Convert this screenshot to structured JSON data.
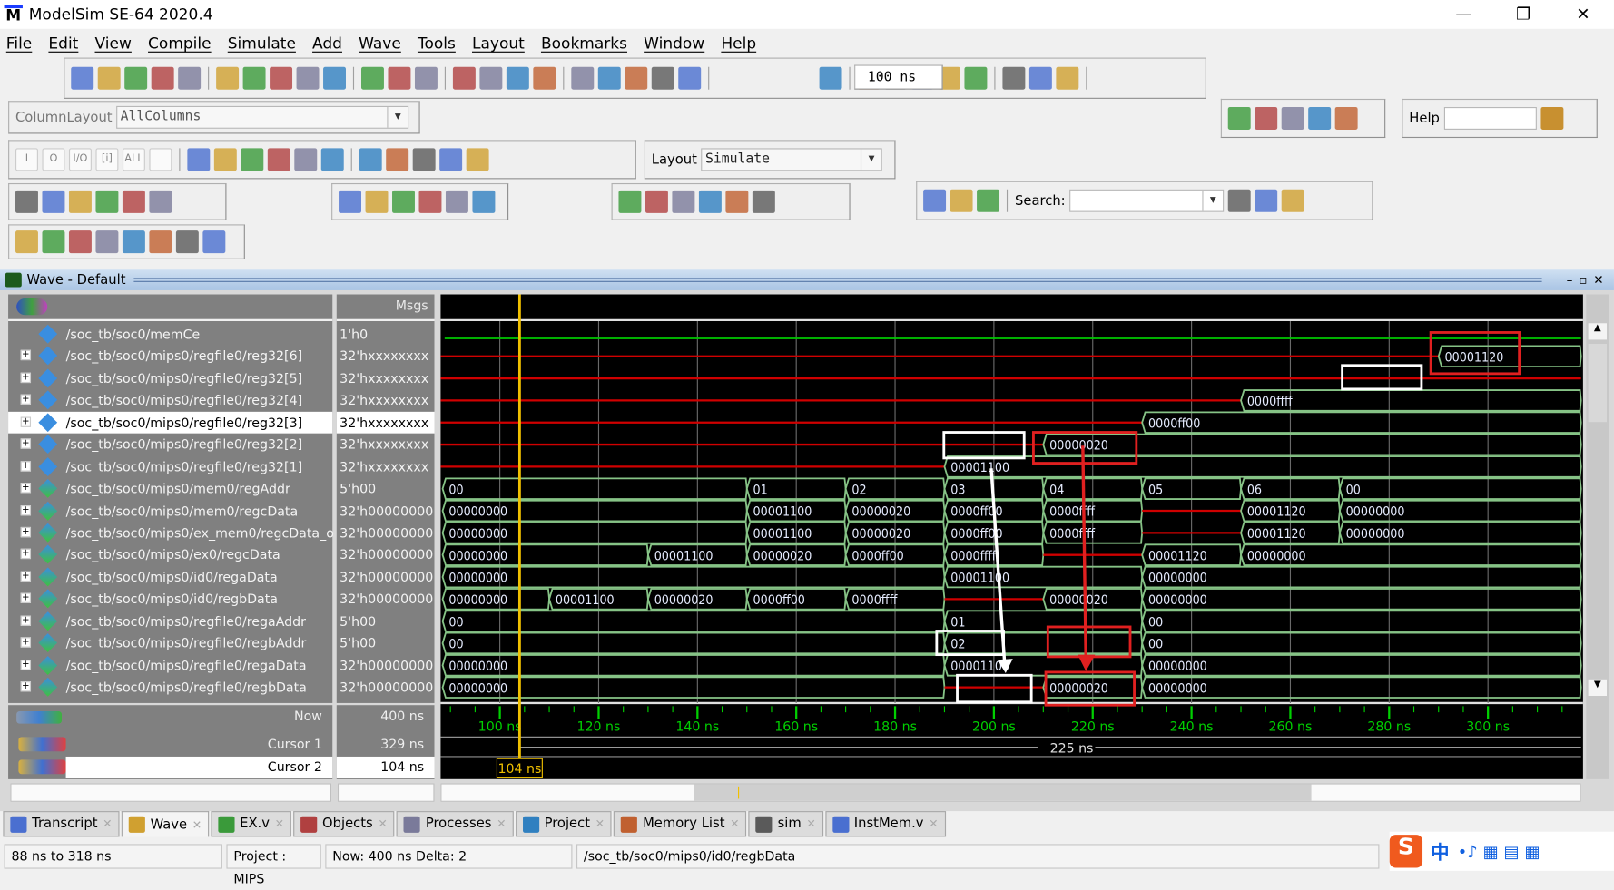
{
  "app": {
    "title": "ModelSim SE-64 2020.4",
    "logo": "M"
  },
  "window_controls": {
    "minimize": "—",
    "restore": "❐",
    "close": "✕"
  },
  "menu": [
    "File",
    "Edit",
    "View",
    "Compile",
    "Simulate",
    "Add",
    "Wave",
    "Tools",
    "Layout",
    "Bookmarks",
    "Window",
    "Help"
  ],
  "toolbar": {
    "row1_groups": [
      [
        "new-file-icon",
        "open-folder-icon",
        "save-icon",
        "reload-icon",
        "print-icon"
      ],
      [
        "cut-icon",
        "copy-icon",
        "paste-icon",
        "undo-icon",
        "redo-icon"
      ],
      [
        "add-icon",
        "find-icon",
        "collapse-icon"
      ],
      [
        "break-icon",
        "break-all-icon",
        "doc-icon",
        "wand-icon"
      ],
      [
        "compile-icon",
        "compile-all-icon",
        "up-arrow-icon",
        "back-arrow-icon",
        "forward-arrow-icon"
      ],
      [
        "restart-icon"
      ],
      [
        "run-icon",
        "continue-icon",
        "run-all-icon",
        "break-run-icon",
        "stop-icon"
      ],
      [
        "performance-icon",
        "memory-icon",
        "hand-icon"
      ]
    ],
    "run_length": "100 ns",
    "column_layout_label": "ColumnLayout",
    "column_layout_value": "AllColumns",
    "right_icons": [
      "download-icon",
      "calendar-icon",
      "table-icon",
      "graph-icon",
      "close-file-icon"
    ],
    "help_label": "Help",
    "help_search_icon": "help-search-icon",
    "row3_filter_icons": [
      "in-filter-icon",
      "out-filter-icon",
      "inout-filter-icon",
      "internal-filter-icon",
      "all-filter-icon",
      "filter-wand-icon"
    ],
    "row3_filter_labels": [
      "I",
      "O",
      "I/O",
      "[i]",
      "ALL",
      ""
    ],
    "row3_step_icons": [
      "step-into-icon",
      "step-over-icon",
      "step-out-icon",
      "step-into-all-icon",
      "step-over-all-icon",
      "step-out-all-icon"
    ],
    "row3_obj_icons": [
      "obj-add-icon",
      "obj-remove-icon",
      "obj-edit-icon",
      "obj-list-icon",
      "obj-go-icon"
    ],
    "layout_label": "Layout",
    "layout_value": "Simulate",
    "row4_mode_icons": [
      "select-mode-icon",
      "zoom-mode-icon",
      "pan-mode-icon",
      "edit-mode-icon",
      "split-mode-icon",
      "stop-signal-icon"
    ],
    "row4_zoom_icons": [
      "zoom-in-icon",
      "zoom-out-icon",
      "zoom-full-icon",
      "zoom-cursor-icon",
      "zoom-cursors-icon",
      "zoom-region-icon"
    ],
    "row4_cursor_icons": [
      "insert-cursor-icon",
      "wave-bar-icon",
      "wave-block-icon",
      "wave-dense-icon",
      "wave-step-icon",
      "wave-edge-icon"
    ],
    "row4_find_icons": [
      "next-edge-icon",
      "prev-edge-icon",
      "find-edge-icon"
    ],
    "search_label": "Search:",
    "search_value": "",
    "search_icons": [
      "search-go-icon",
      "search-prev-icon",
      "search-next-icon"
    ],
    "row5_icons": [
      "add-cursor-icon",
      "delete-cursor-icon",
      "prev-transition-icon",
      "next-transition-icon",
      "prev-rise-icon",
      "next-rise-icon",
      "prev-fall-icon",
      "next-fall-icon"
    ]
  },
  "wave_window": {
    "title": "Wave - Default",
    "msgs_header": "Msgs",
    "now_label": "Now",
    "now_value": "400 ns",
    "cursor1_label": "Cursor 1",
    "cursor1_value": "329 ns",
    "cursor2_label": "Cursor 2",
    "cursor2_value": "104 ns",
    "cursor2_time": 104,
    "cursor_delta_label": "225 ns",
    "selected_row": 4,
    "signals": [
      {
        "name": "/soc_tb/soc0/memCe",
        "value": "1'h0",
        "bits": 1,
        "wave": [
          [
            88,
            "0"
          ]
        ]
      },
      {
        "name": "/soc_tb/soc0/mips0/regfile0/reg32[6]",
        "value": "32'hxxxxxxxx",
        "wave": [
          [
            88,
            "x"
          ],
          [
            290,
            "00001120"
          ]
        ]
      },
      {
        "name": "/soc_tb/soc0/mips0/regfile0/reg32[5]",
        "value": "32'hxxxxxxxx",
        "wave": [
          [
            88,
            "x"
          ]
        ]
      },
      {
        "name": "/soc_tb/soc0/mips0/regfile0/reg32[4]",
        "value": "32'hxxxxxxxx",
        "wave": [
          [
            88,
            "x"
          ],
          [
            250,
            "0000ffff"
          ]
        ]
      },
      {
        "name": "/soc_tb/soc0/mips0/regfile0/reg32[3]",
        "value": "32'hxxxxxxxx",
        "wave": [
          [
            88,
            "x"
          ],
          [
            230,
            "0000ff00"
          ]
        ]
      },
      {
        "name": "/soc_tb/soc0/mips0/regfile0/reg32[2]",
        "value": "32'hxxxxxxxx",
        "wave": [
          [
            88,
            "x"
          ],
          [
            210,
            "00000020"
          ]
        ]
      },
      {
        "name": "/soc_tb/soc0/mips0/regfile0/reg32[1]",
        "value": "32'hxxxxxxxx",
        "wave": [
          [
            88,
            "x"
          ],
          [
            190,
            "00001100"
          ]
        ]
      },
      {
        "name": "/soc_tb/soc0/mips0/mem0/regAddr",
        "value": "5'h00",
        "wave": [
          [
            88,
            "00"
          ],
          [
            150,
            "01"
          ],
          [
            170,
            "02"
          ],
          [
            190,
            "03"
          ],
          [
            210,
            "04"
          ],
          [
            230,
            "05"
          ],
          [
            250,
            "06"
          ],
          [
            270,
            "00"
          ]
        ]
      },
      {
        "name": "/soc_tb/soc0/mips0/mem0/regcData",
        "value": "32'h00000000",
        "wave": [
          [
            88,
            "00000000"
          ],
          [
            150,
            "00001100"
          ],
          [
            170,
            "00000020"
          ],
          [
            190,
            "0000ff00"
          ],
          [
            210,
            "0000ffff"
          ],
          [
            230,
            "x"
          ],
          [
            250,
            "00001120"
          ],
          [
            270,
            "00000000"
          ]
        ]
      },
      {
        "name": "/soc_tb/soc0/mips0/ex_mem0/regcData_o",
        "value": "32'h00000000",
        "wave": [
          [
            88,
            "00000000"
          ],
          [
            150,
            "00001100"
          ],
          [
            170,
            "00000020"
          ],
          [
            190,
            "0000ff00"
          ],
          [
            210,
            "0000ffff"
          ],
          [
            230,
            "x"
          ],
          [
            250,
            "00001120"
          ],
          [
            270,
            "00000000"
          ]
        ]
      },
      {
        "name": "/soc_tb/soc0/mips0/ex0/regcData",
        "value": "32'h00000000",
        "wave": [
          [
            88,
            "00000000"
          ],
          [
            130,
            "00001100"
          ],
          [
            150,
            "00000020"
          ],
          [
            170,
            "0000ff00"
          ],
          [
            190,
            "0000ffff"
          ],
          [
            210,
            "x"
          ],
          [
            230,
            "00001120"
          ],
          [
            250,
            "00000000"
          ]
        ]
      },
      {
        "name": "/soc_tb/soc0/mips0/id0/regaData",
        "value": "32'h00000000",
        "wave": [
          [
            88,
            "00000000"
          ],
          [
            190,
            "00001100"
          ],
          [
            230,
            "00000000"
          ]
        ]
      },
      {
        "name": "/soc_tb/soc0/mips0/id0/regbData",
        "value": "32'h00000000",
        "wave": [
          [
            88,
            "00000000"
          ],
          [
            110,
            "00001100"
          ],
          [
            130,
            "00000020"
          ],
          [
            150,
            "0000ff00"
          ],
          [
            170,
            "0000ffff"
          ],
          [
            190,
            "x"
          ],
          [
            210,
            "00000020"
          ],
          [
            230,
            "00000000"
          ]
        ]
      },
      {
        "name": "/soc_tb/soc0/mips0/regfile0/regaAddr",
        "value": "5'h00",
        "wave": [
          [
            88,
            "00"
          ],
          [
            190,
            "01"
          ],
          [
            230,
            "00"
          ]
        ]
      },
      {
        "name": "/soc_tb/soc0/mips0/regfile0/regbAddr",
        "value": "5'h00",
        "wave": [
          [
            88,
            "00"
          ],
          [
            190,
            "02"
          ],
          [
            230,
            "00"
          ]
        ]
      },
      {
        "name": "/soc_tb/soc0/mips0/regfile0/regaData",
        "value": "32'h00000000",
        "wave": [
          [
            88,
            "00000000"
          ],
          [
            190,
            "00001100"
          ],
          [
            230,
            "00000000"
          ]
        ]
      },
      {
        "name": "/soc_tb/soc0/mips0/regfile0/regbData",
        "value": "32'h00000000",
        "wave": [
          [
            88,
            "00000000"
          ],
          [
            190,
            "x"
          ],
          [
            210,
            "00000020"
          ],
          [
            230,
            "00000000"
          ]
        ]
      }
    ],
    "time_axis": {
      "start": 88,
      "end": 318,
      "unit": "ns",
      "labels": [
        "100 ns",
        "120 ns",
        "140 ns",
        "160 ns",
        "180 ns",
        "200 ns",
        "220 ns",
        "240 ns",
        "260 ns",
        "280 ns",
        "300 ns"
      ]
    },
    "colors": {
      "bus": "#86c386",
      "logic": "#00c800",
      "undefined": "#d00000",
      "cursor": "#f0c000",
      "axis": "#00d000",
      "background": "#000000",
      "annotation_red": "#e02020",
      "annotation_white": "#ffffff"
    }
  },
  "tabs": [
    {
      "label": "Transcript",
      "icon": "transcript-icon"
    },
    {
      "label": "Wave",
      "icon": "wave-icon",
      "active": true
    },
    {
      "label": "EX.v",
      "icon": "verilog-file-icon"
    },
    {
      "label": "Objects",
      "icon": "objects-icon"
    },
    {
      "label": "Processes",
      "icon": "processes-icon"
    },
    {
      "label": "Project",
      "icon": "project-icon"
    },
    {
      "label": "Memory List",
      "icon": "memory-list-icon"
    },
    {
      "label": "sim",
      "icon": "sim-icon"
    },
    {
      "label": "InstMem.v",
      "icon": "verilog-file-icon"
    }
  ],
  "status": {
    "range": "88 ns to 318 ns",
    "project": "Project : MIPS",
    "now": "Now: 400 ns  Delta: 2",
    "path": "/soc_tb/soc0/mips0/id0/regbData"
  },
  "ime": {
    "lang": "中"
  }
}
